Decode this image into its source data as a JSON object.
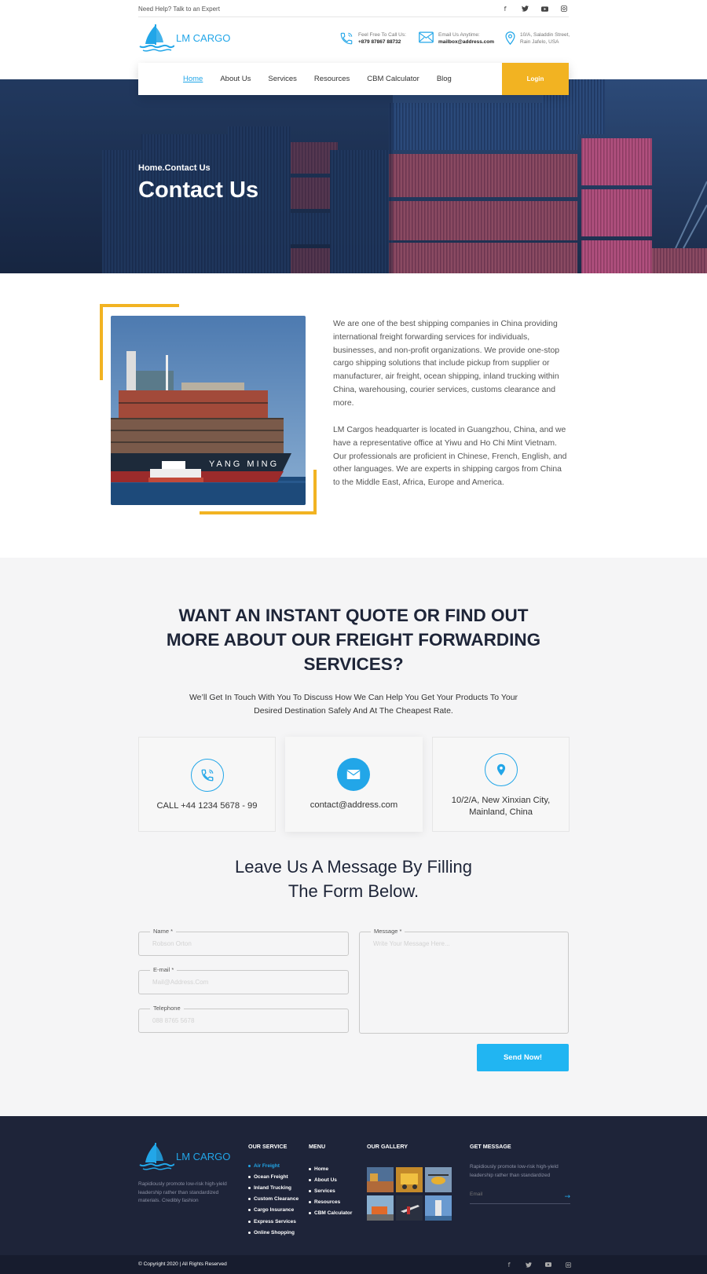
{
  "topbar": {
    "help_text": "Need Help? Talk to an Expert",
    "social_icons": [
      "facebook-icon",
      "twitter-icon",
      "youtube-icon",
      "instagram-icon"
    ]
  },
  "header": {
    "logo_text": "LM CARGO",
    "phone": {
      "label": "Feel Free To Call Us:",
      "value": "+879 87867 88732"
    },
    "email": {
      "label": "Email Us Anytime:",
      "value": "mailbox@address.com"
    },
    "address": {
      "line1": "10/A, Saladdin Street,",
      "line2": "Rain Jafelo, USA"
    }
  },
  "nav": {
    "items": [
      {
        "label": "Home",
        "active": true
      },
      {
        "label": "About Us"
      },
      {
        "label": "Services"
      },
      {
        "label": "Resources"
      },
      {
        "label": "CBM Calculator"
      },
      {
        "label": "Blog"
      }
    ],
    "login_label": "Login"
  },
  "hero": {
    "breadcrumb": "Home.Contact Us",
    "title": "Contact Us"
  },
  "about": {
    "paragraph1": "We are one of the best shipping companies in China providing international freight forwarding services for individuals, businesses, and non-profit organizations. We provide one-stop cargo shipping solutions that include pickup from supplier or manufacturer, air freight, ocean shipping, inland trucking within China, warehousing, courier services, customs clearance and more.",
    "paragraph2": "LM Cargos headquarter is located in Guangzhou, China, and we have a representative office at  Yiwu and Ho Chi Mint Vietnam. Our professionals are proficient in Chinese, French, English, and other languages. We are experts in shipping cargos from China to the Middle East, Africa, Europe and America."
  },
  "quote": {
    "title_line1": "WANT AN INSTANT QUOTE OR FIND OUT",
    "title_line2": "MORE ABOUT OUR FREIGHT FORWARDING",
    "title_line3": "SERVICES?",
    "subtitle_line1": "We’ll Get In Touch With You To Discuss How We Can Help You Get Your Products To Your",
    "subtitle_line2": "Desired Destination Safely And At The Cheapest Rate."
  },
  "cards": {
    "phone": "CALL +44 1234 5678 - 99",
    "email": "contact@address.com",
    "address_line1": "10/2/A, New Xinxian City,",
    "address_line2": "Mainland, China"
  },
  "form": {
    "title_line1": "Leave Us A Message By Filling",
    "title_line2": "The Form Below.",
    "name_label": "Name *",
    "name_placeholder": "Robson Orton",
    "email_label": "E-mail *",
    "email_placeholder": "Mail@Address.Com",
    "telephone_label": "Telephone",
    "telephone_placeholder": "088 8765 5678",
    "message_label": "Message *",
    "message_placeholder": "Write Your Message Here...",
    "submit_label": "Send Now!"
  },
  "footer": {
    "logo_text": "LM CARGO",
    "about_text_line1": "Rapidiously promote low-risk high-yield",
    "about_text_line2": "leadership rather than standardized",
    "about_text_line3": "materials. Credibly fashion",
    "service_heading": "OUR SERVICE",
    "services": [
      "Air Freight",
      "Ocean Freight",
      "Inland Trucking",
      "Custom Clearance",
      "Cargo Insurance",
      "Express Services",
      "Online Shopping"
    ],
    "menu_heading": "MENU",
    "menu": [
      "Home",
      "About Us",
      "Services",
      "Resources",
      "CBM Calculator"
    ],
    "gallery_heading": "OUR GALLERY",
    "message_heading": "GET MESSAGE",
    "message_text_line1": "Rapidiously promote low-risk high-yield",
    "message_text_line2": "leadership rather than standardized",
    "email_placeholder": "Email",
    "copyright": "© Copyright 2020 | All Rights Reserved"
  },
  "colors": {
    "accent": "#22a6e8",
    "gold": "#f2b322",
    "dark_navy": "#1e2439",
    "heading": "#1e2538"
  }
}
